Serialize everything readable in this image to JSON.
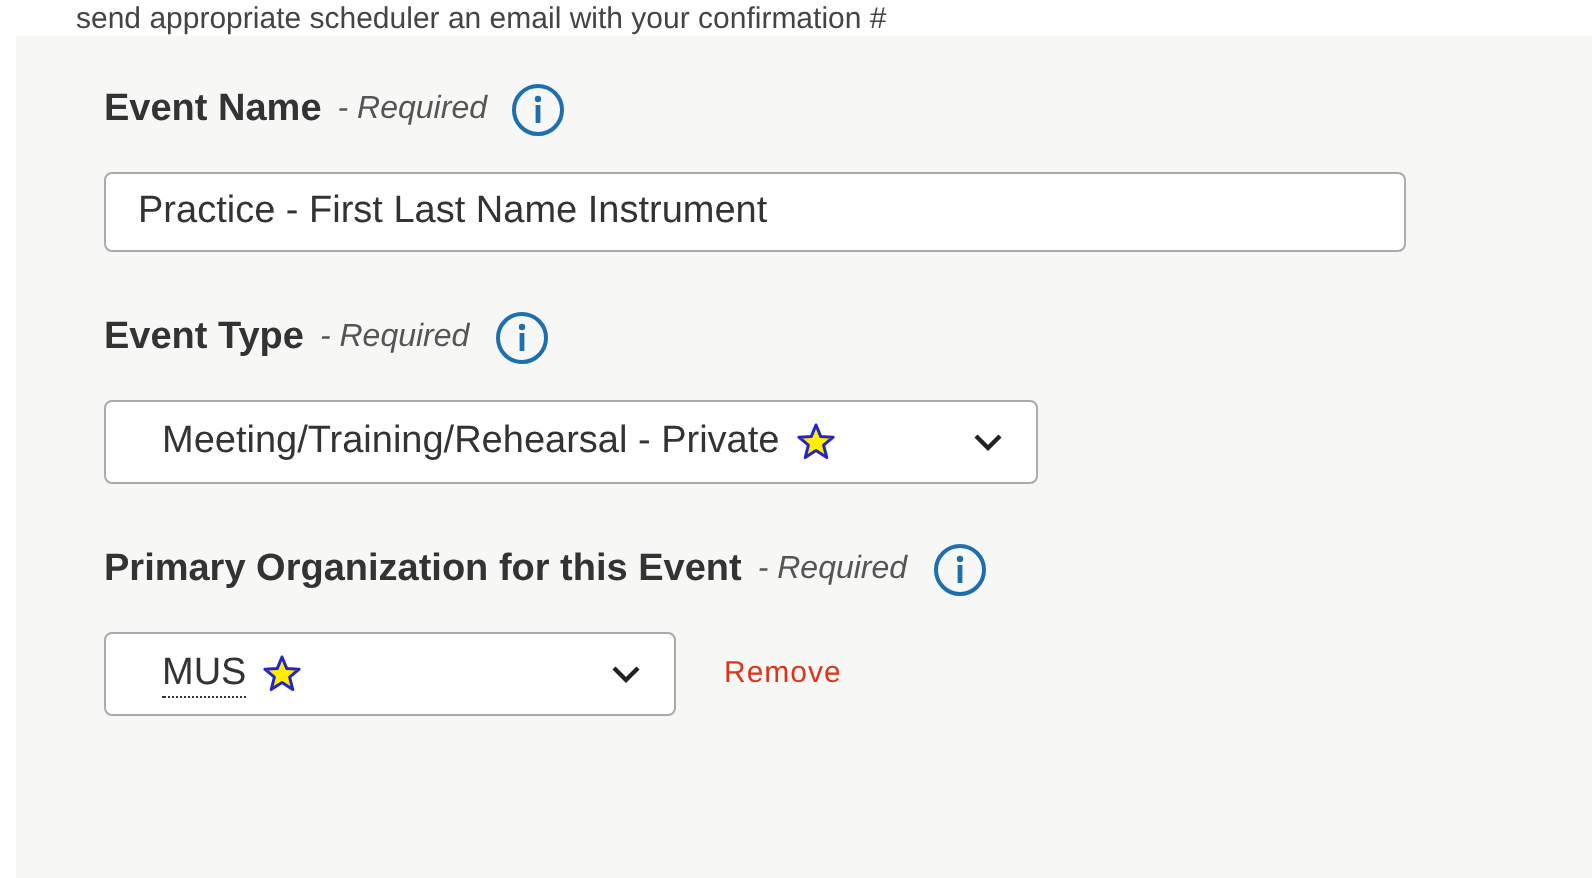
{
  "intro_text": "send appropriate scheduler an email with your confirmation #",
  "fields": [
    {
      "kind": "text",
      "label": "Event Name",
      "required_note": "- Required",
      "value": "Practice - First Last Name Instrument"
    },
    {
      "kind": "select",
      "label": "Event Type",
      "required_note": "- Required",
      "value": "Meeting/Training/Rehearsal - Private",
      "starred": true
    },
    {
      "kind": "select",
      "label": "Primary Organization for this Event",
      "required_note": "- Required",
      "value": "MUS",
      "starred": true,
      "underlined": true,
      "remove_label": "Remove"
    }
  ]
}
